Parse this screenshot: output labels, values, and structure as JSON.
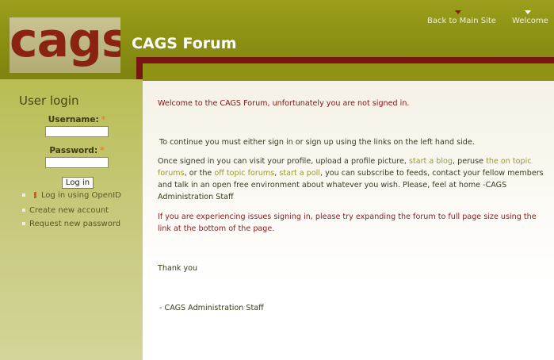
{
  "header": {
    "logo_text": "cags",
    "title": "CAGS Forum",
    "links": {
      "back": "Back to Main Site",
      "welcome": "Welcome"
    }
  },
  "sidebar": {
    "login_title": "User login",
    "username_label": "Username:",
    "password_label": "Password:",
    "required_marker": "*",
    "username_value": "",
    "password_value": "",
    "login_button": "Log in",
    "items": [
      {
        "label": "Log in using OpenID"
      },
      {
        "label": "Create new account"
      },
      {
        "label": "Request new password"
      }
    ]
  },
  "content": {
    "welcome": "Welcome to the CAGS Forum, unfortunately you are not signed in.",
    "continue": "To continue you must either sign in or sign up using the links on the left hand side.",
    "once": {
      "t1": "Once signed in you can visit your profile, upload a profile picture, ",
      "blog": "start a blog",
      "t2": ", peruse ",
      "ontopic": "the on topic forums",
      "t3": ", or the ",
      "offtopic": "off topic forums",
      "t4": ", ",
      "poll": "start a poll",
      "t5": ", you can subscribe to feeds, contact your fellow members and talk in an open free environment about whatever you wish. Please, feel at home -CAGS Administration Staff"
    },
    "issues": "If you are experiencing issues signing in, please try expanding the forum to full page size using the link at the bottom of the page.",
    "thanks": "Thank you",
    "staff": "- CAGS Administration Staff"
  },
  "colors": {
    "header": "#8f9213",
    "accent_dark": "#7a1515",
    "logo_text": "#8a2311",
    "link": "#9b9a2f"
  }
}
